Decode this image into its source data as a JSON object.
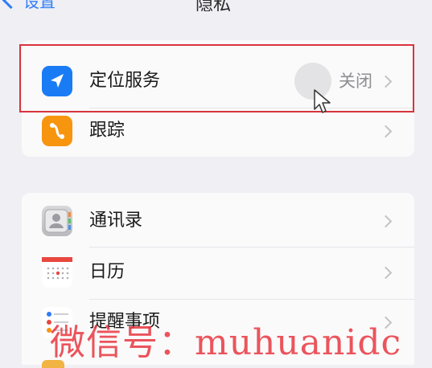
{
  "nav": {
    "back_label": "设置",
    "title": "隐私"
  },
  "group1": [
    {
      "label": "定位服务",
      "value": "关闭",
      "icon": "location-arrow-icon"
    },
    {
      "label": "跟踪",
      "icon": "tracking-icon"
    }
  ],
  "group2": [
    {
      "label": "通讯录",
      "icon": "contacts-icon"
    },
    {
      "label": "日历",
      "icon": "calendar-icon"
    },
    {
      "label": "提醒事项",
      "icon": "reminders-icon"
    }
  ],
  "watermark": "微信号：muhuanidc",
  "colors": {
    "accent": "#1a7cf5",
    "tracking": "#f7950f",
    "highlight": "#d9343d",
    "watermark": "#e83c46"
  }
}
